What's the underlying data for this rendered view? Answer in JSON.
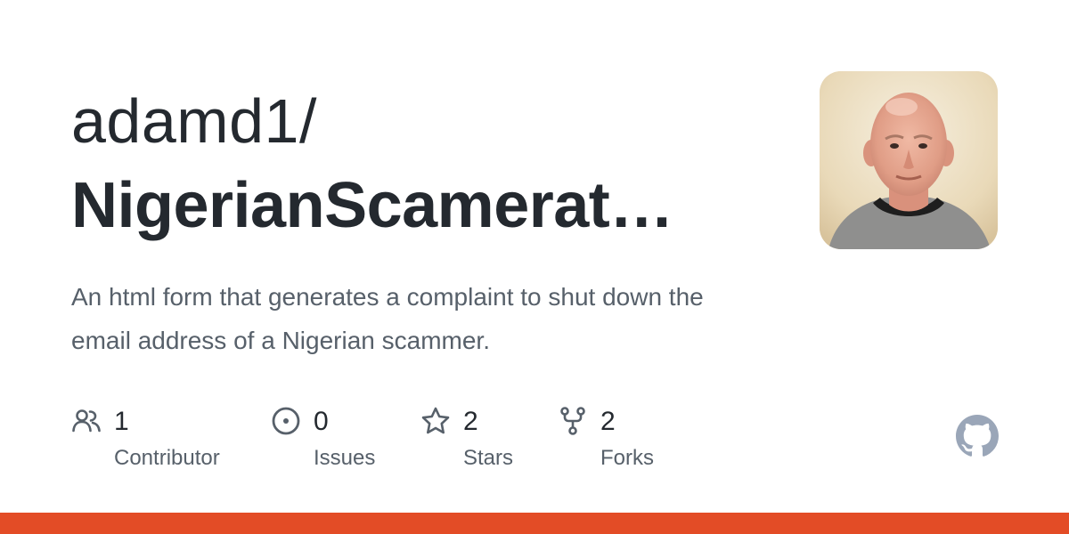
{
  "repo": {
    "owner": "adamd1/",
    "name": "NigerianScamerat…",
    "description": "An html form that generates a complaint to shut down the email address of a Nigerian scammer."
  },
  "stats": [
    {
      "icon": "people-icon",
      "count": "1",
      "label": "Contributor"
    },
    {
      "icon": "issue-icon",
      "count": "0",
      "label": "Issues"
    },
    {
      "icon": "star-icon",
      "count": "2",
      "label": "Stars"
    },
    {
      "icon": "fork-icon",
      "count": "2",
      "label": "Forks"
    }
  ],
  "colors": {
    "title": "#24292f",
    "muted": "#57606a",
    "icon": "#57606a",
    "logo": "#9aa6b8",
    "language_bar": "#e34c26"
  },
  "logo_icon": "github-mark-icon"
}
